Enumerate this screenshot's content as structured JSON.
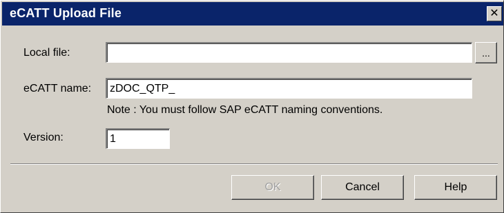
{
  "window": {
    "title": "eCATT Upload File",
    "close_label": "✕"
  },
  "form": {
    "local_file_label": "Local file:",
    "local_file_value": "",
    "browse_label": "...",
    "ecatt_name_label": "eCATT name:",
    "ecatt_name_value": "zDOC_QTP_",
    "note": "Note : You must follow SAP eCATT naming conventions.",
    "version_label": "Version:",
    "version_value": "1"
  },
  "buttons": {
    "ok": "OK",
    "cancel": "Cancel",
    "help": "Help"
  },
  "colors": {
    "title_bar": "#0a246a",
    "face": "#d4d0c8"
  }
}
